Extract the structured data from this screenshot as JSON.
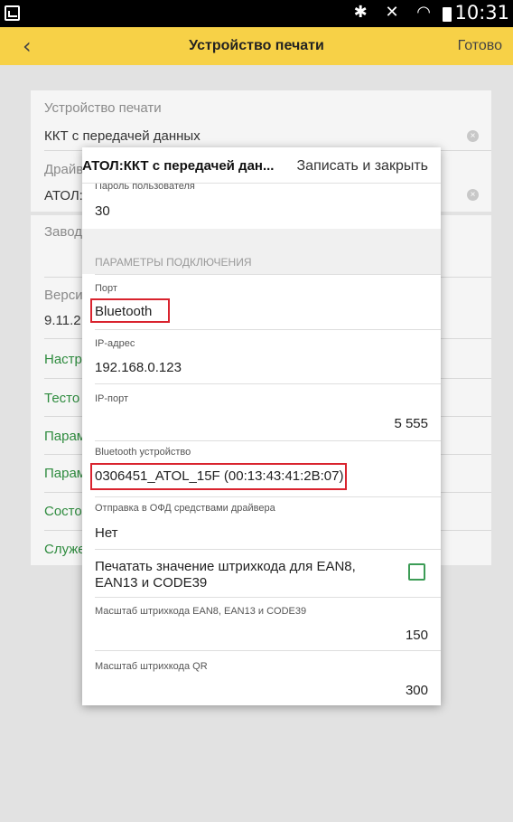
{
  "statusbar": {
    "icons": "✱ ✕ ◠",
    "time": "10:31"
  },
  "topbar": {
    "back_icon": "chevron-left",
    "title": "Устройство печати",
    "done_label": "Готово"
  },
  "background_form": {
    "device_label": "Устройство печати",
    "device_value": "ККТ с передачей данных",
    "driver_label": "Драйв",
    "driver_value": "АТОЛ:",
    "serial_label": "Завод",
    "version_label": "Верси",
    "version_value": "9.11.2",
    "links": [
      "Настр",
      "Тесто",
      "Парам",
      "Парам",
      "Состо",
      "Служе"
    ]
  },
  "modal": {
    "title": "АТОЛ:ККТ с передачей дан...",
    "save_close_label": "Записать и закрыть",
    "user_password_label": "Пароль пользователя",
    "user_password_value": "30",
    "connection_section": "ПАРАМЕТРЫ ПОДКЛЮЧЕНИЯ",
    "port_label": "Порт",
    "port_value": "Bluetooth",
    "ip_label": "IP-адрес",
    "ip_value": "192.168.0.123",
    "ip_port_label": "IP-порт",
    "ip_port_value": "5 555",
    "bt_device_label": "Bluetooth устройство",
    "bt_device_value": "0306451_ATOL_15F (00:13:43:41:2B:07)",
    "ofd_label": "Отправка в ОФД средствами драйвера",
    "ofd_value": "Нет",
    "print_barcode_line1": "Печатать значение штрихкода для EAN8,",
    "print_barcode_line2": "EAN13 и CODE39",
    "print_barcode_checked": false,
    "scale_ean_label": "Масштаб штрихкода EAN8, EAN13 и CODE39",
    "scale_ean_value": "150",
    "scale_qr_label": "Масштаб штрихкода QR",
    "scale_qr_value": "300"
  },
  "colors": {
    "topbar": "#f7d147",
    "link": "#2e8b3e",
    "highlight": "#d9232e",
    "checkbox": "#3c9c56"
  }
}
